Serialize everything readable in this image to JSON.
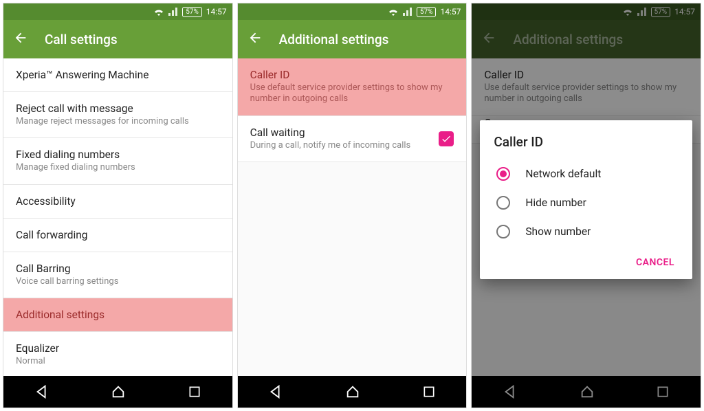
{
  "status": {
    "battery": "57%",
    "time": "14:57"
  },
  "accent": "#e91e88",
  "screen1": {
    "title": "Call settings",
    "items": [
      {
        "label": "Xperia™ Answering Machine",
        "sub": ""
      },
      {
        "label": "Reject call with message",
        "sub": "Manage reject messages for incoming calls"
      },
      {
        "label": "Fixed dialing numbers",
        "sub": "Manage fixed dialing numbers"
      },
      {
        "label": "Accessibility",
        "sub": ""
      },
      {
        "label": "Call forwarding",
        "sub": ""
      },
      {
        "label": "Call Barring",
        "sub": "Voice call barring settings"
      },
      {
        "label": "Additional settings",
        "sub": ""
      },
      {
        "label": "Equalizer",
        "sub": "Normal"
      }
    ]
  },
  "screen2": {
    "title": "Additional settings",
    "caller_id": {
      "label": "Caller ID",
      "sub": "Use default service provider settings to show my number in outgoing calls"
    },
    "call_waiting": {
      "label": "Call waiting",
      "sub": "During a call, notify me of incoming calls",
      "checked": true
    }
  },
  "screen3": {
    "title": "Additional settings",
    "dialog": {
      "title": "Caller ID",
      "options": [
        {
          "label": "Network default",
          "selected": true
        },
        {
          "label": "Hide number",
          "selected": false
        },
        {
          "label": "Show number",
          "selected": false
        }
      ],
      "cancel": "CANCEL"
    }
  }
}
